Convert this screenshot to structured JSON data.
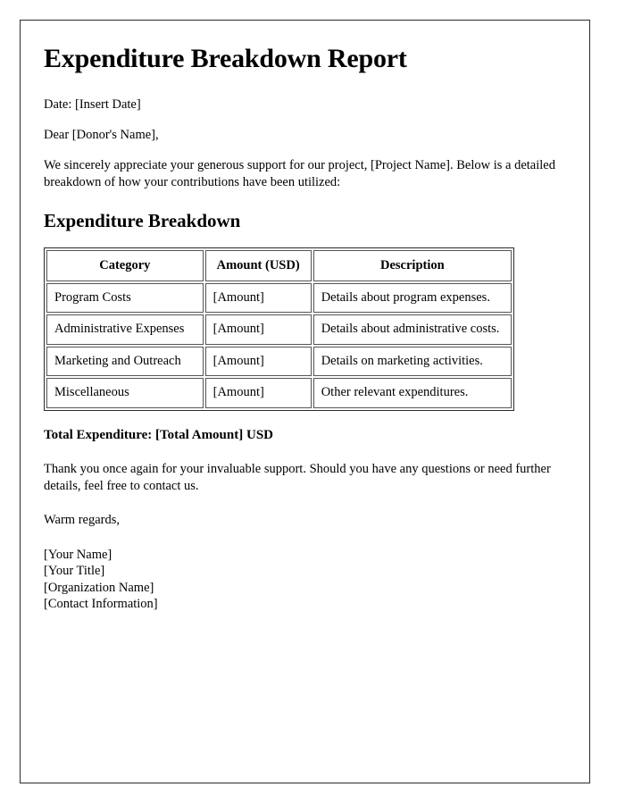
{
  "document": {
    "title": "Expenditure Breakdown Report",
    "date_line": "Date: [Insert Date]",
    "salutation": "Dear [Donor's Name],",
    "intro_paragraph": "We sincerely appreciate your generous support for our project, [Project Name]. Below is a detailed breakdown of how your contributions have been utilized:",
    "section_title": "Expenditure Breakdown",
    "total_line": "Total Expenditure: [Total Amount] USD",
    "closing_paragraph": "Thank you once again for your invaluable support. Should you have any questions or need further details, feel free to contact us.",
    "regards": "Warm regards,",
    "signature": {
      "name": "[Your Name]",
      "title": "[Your Title]",
      "organization": "[Organization Name]",
      "contact": "[Contact Information]"
    }
  },
  "table": {
    "headers": {
      "category": "Category",
      "amount": "Amount (USD)",
      "description": "Description"
    },
    "rows": [
      {
        "category": "Program Costs",
        "amount": "[Amount]",
        "description": "Details about program expenses."
      },
      {
        "category": "Administrative Expenses",
        "amount": "[Amount]",
        "description": "Details about administrative costs."
      },
      {
        "category": "Marketing and Outreach",
        "amount": "[Amount]",
        "description": "Details on marketing activities."
      },
      {
        "category": "Miscellaneous",
        "amount": "[Amount]",
        "description": "Other relevant expenditures."
      }
    ]
  },
  "colors": {
    "page_border": "#2b2b2b",
    "text": "#000000",
    "table_border": "#555555",
    "background": "#ffffff"
  }
}
